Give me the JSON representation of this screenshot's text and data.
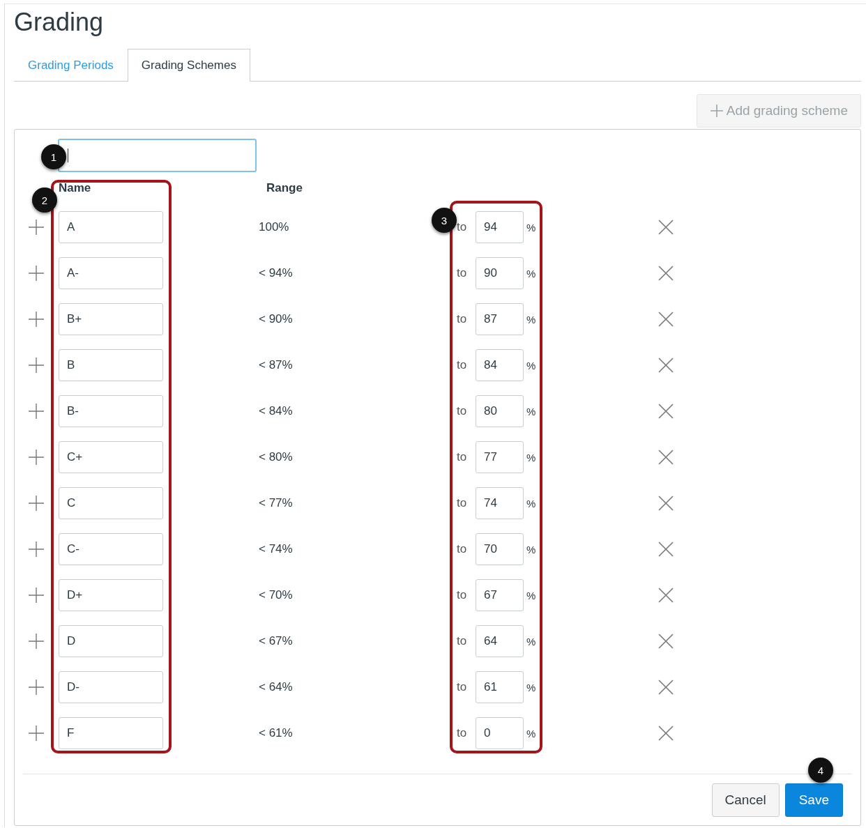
{
  "page_title": "Grading",
  "tabs": [
    {
      "label": "Grading Periods",
      "selected": false
    },
    {
      "label": "Grading Schemes",
      "selected": true
    }
  ],
  "add_button": {
    "label": "Add grading scheme",
    "disabled": true
  },
  "scheme_name_field": {
    "focused": true
  },
  "columns": [
    "Name",
    "Range"
  ],
  "rows": [
    {
      "name": "A",
      "range": "100%",
      "to": "to",
      "min": "94",
      "unit": "%"
    },
    {
      "name": "A-",
      "range": "< 94%",
      "to": "to",
      "min": "90",
      "unit": "%"
    },
    {
      "name": "B+",
      "range": "< 90%",
      "to": "to",
      "min": "87",
      "unit": "%"
    },
    {
      "name": "B",
      "range": "< 87%",
      "to": "to",
      "min": "84",
      "unit": "%"
    },
    {
      "name": "B-",
      "range": "< 84%",
      "to": "to",
      "min": "80",
      "unit": "%"
    },
    {
      "name": "C+",
      "range": "< 80%",
      "to": "to",
      "min": "77",
      "unit": "%"
    },
    {
      "name": "C",
      "range": "< 77%",
      "to": "to",
      "min": "74",
      "unit": "%"
    },
    {
      "name": "C-",
      "range": "< 74%",
      "to": "to",
      "min": "70",
      "unit": "%"
    },
    {
      "name": "D+",
      "range": "< 70%",
      "to": "to",
      "min": "67",
      "unit": "%"
    },
    {
      "name": "D",
      "range": "< 67%",
      "to": "to",
      "min": "64",
      "unit": "%"
    },
    {
      "name": "D-",
      "range": "< 64%",
      "to": "to",
      "min": "61",
      "unit": "%"
    },
    {
      "name": "F",
      "range": "< 61%",
      "to": "to",
      "min": "0",
      "unit": "%"
    }
  ],
  "buttons": [
    {
      "label": "Cancel",
      "kind": "secondary"
    },
    {
      "label": "Save",
      "kind": "primary"
    }
  ],
  "callouts": [
    "1",
    "2",
    "3",
    "4"
  ]
}
